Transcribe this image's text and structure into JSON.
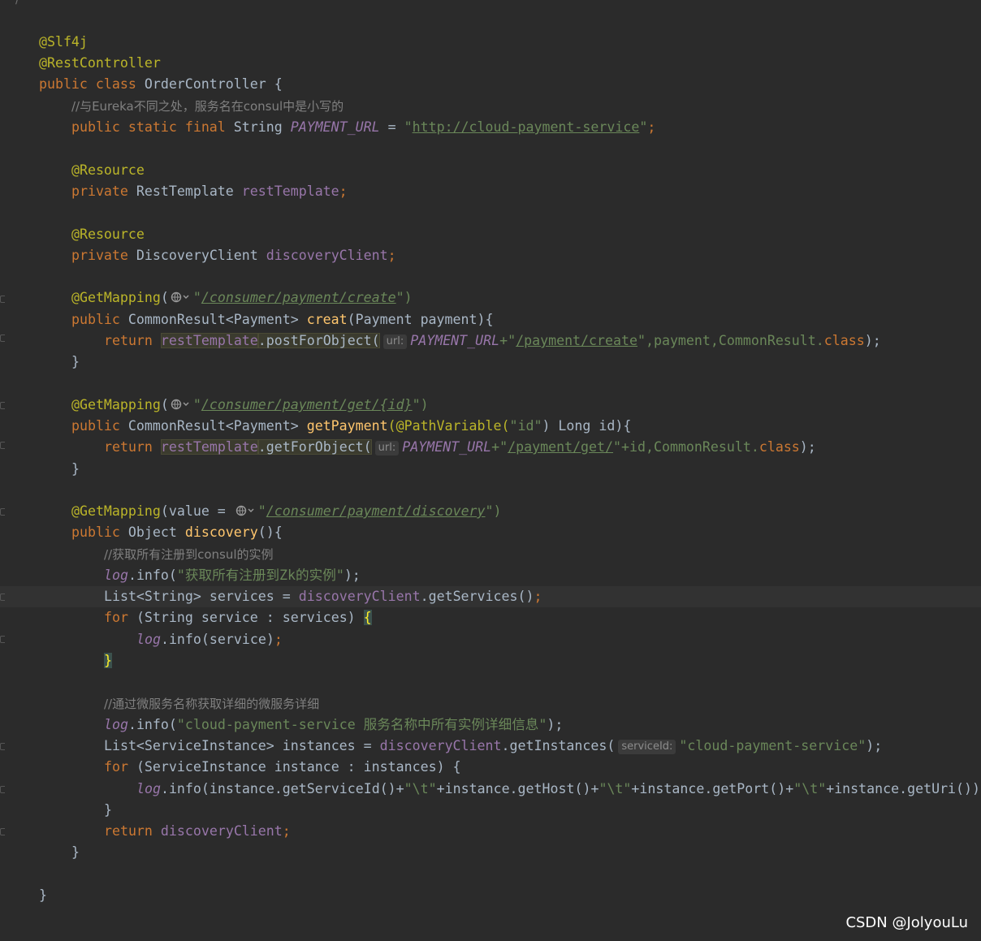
{
  "editor": {
    "top_comment": "*/",
    "lines": {
      "ann_slf4j": "@Slf4j",
      "ann_rest": "@RestController",
      "class_kw": "public class ",
      "class_name": "OrderController {",
      "comment_eureka": "//与Eureka不同之处，服务名在consul中是小写的",
      "field_mods": "public static final ",
      "field_type": "String ",
      "field_const": "PAYMENT_URL",
      "field_eq": " = ",
      "field_quote_open": "\"",
      "field_url": "http://cloud-payment-service",
      "field_quote_close": "\"",
      "semicolon": ";",
      "ann_resource": "@Resource",
      "private_kw": "private ",
      "rest_type": "RestTemplate ",
      "rest_field": "restTemplate",
      "disc_type": "DiscoveryClient ",
      "disc_field": "discoveryClient",
      "getmapping": "@GetMapping",
      "paren_open": "(",
      "paren_close_str": "\")",
      "url_create": "/consumer/payment/create",
      "public_kw": "public ",
      "common_result": "CommonResult<Payment> ",
      "creat_method": "creat",
      "creat_params": "(Payment payment){",
      "return_kw": "return ",
      "post_for_object": ".postForObject(",
      "hint_url": "url:",
      "plus_quote": "+\"",
      "url_payment_create": "/payment/create",
      "after_create": "\",payment,CommonResult.",
      "class_kw2": "class",
      "close_stmt": ");",
      "close_brace": "}",
      "url_get_id": "/consumer/payment/get/{id}",
      "get_payment_method": "getPayment",
      "path_variable": "(@PathVariable(",
      "id_str": "\"id\"",
      "long_id": ") Long id){",
      "get_for_object": ".getForObject(",
      "url_payment_get": "/payment/get/",
      "after_get": "\"+id,CommonResult.",
      "value_eq": "(value = ",
      "url_discovery": "/consumer/payment/discovery",
      "object_type": "Object ",
      "discovery_method": "discovery",
      "discovery_params": "(){",
      "comment_get_all": "//获取所有注册到consul的实例",
      "log": "log",
      "info_open": ".info(",
      "info_str_zk": "\"获取所有注册到Zk的实例\"",
      "list_string": "List<String> services = ",
      "get_services": ".getServices()",
      "for_kw": "for ",
      "for_services": "(String service : services) ",
      "open_brace": "{",
      "log_service": ".info(service)",
      "comment_detail": "//通过微服务名称获取详细的微服务详细",
      "info_str_detail": "\"cloud-payment-service 服务名称中所有实例详细信息\"",
      "list_instances": "List<ServiceInstance> instances = ",
      "get_instances": ".getInstances(",
      "hint_service_id": "serviceId:",
      "service_id_str": "\"cloud-payment-service\"",
      "for_instances": "(ServiceInstance instance : instances) {",
      "log_instance_1": ".info(instance.getServiceId()+",
      "tab_str": "\"\\t\"",
      "log_instance_2": "+instance.getHost()+",
      "log_instance_3": "+instance.getPort()+",
      "log_instance_4": "+instance.getUri())",
      "return_disc": "discoveryClient",
      "close_paren_semicolon": ");"
    }
  },
  "watermark": "CSDN @JolyouLu"
}
